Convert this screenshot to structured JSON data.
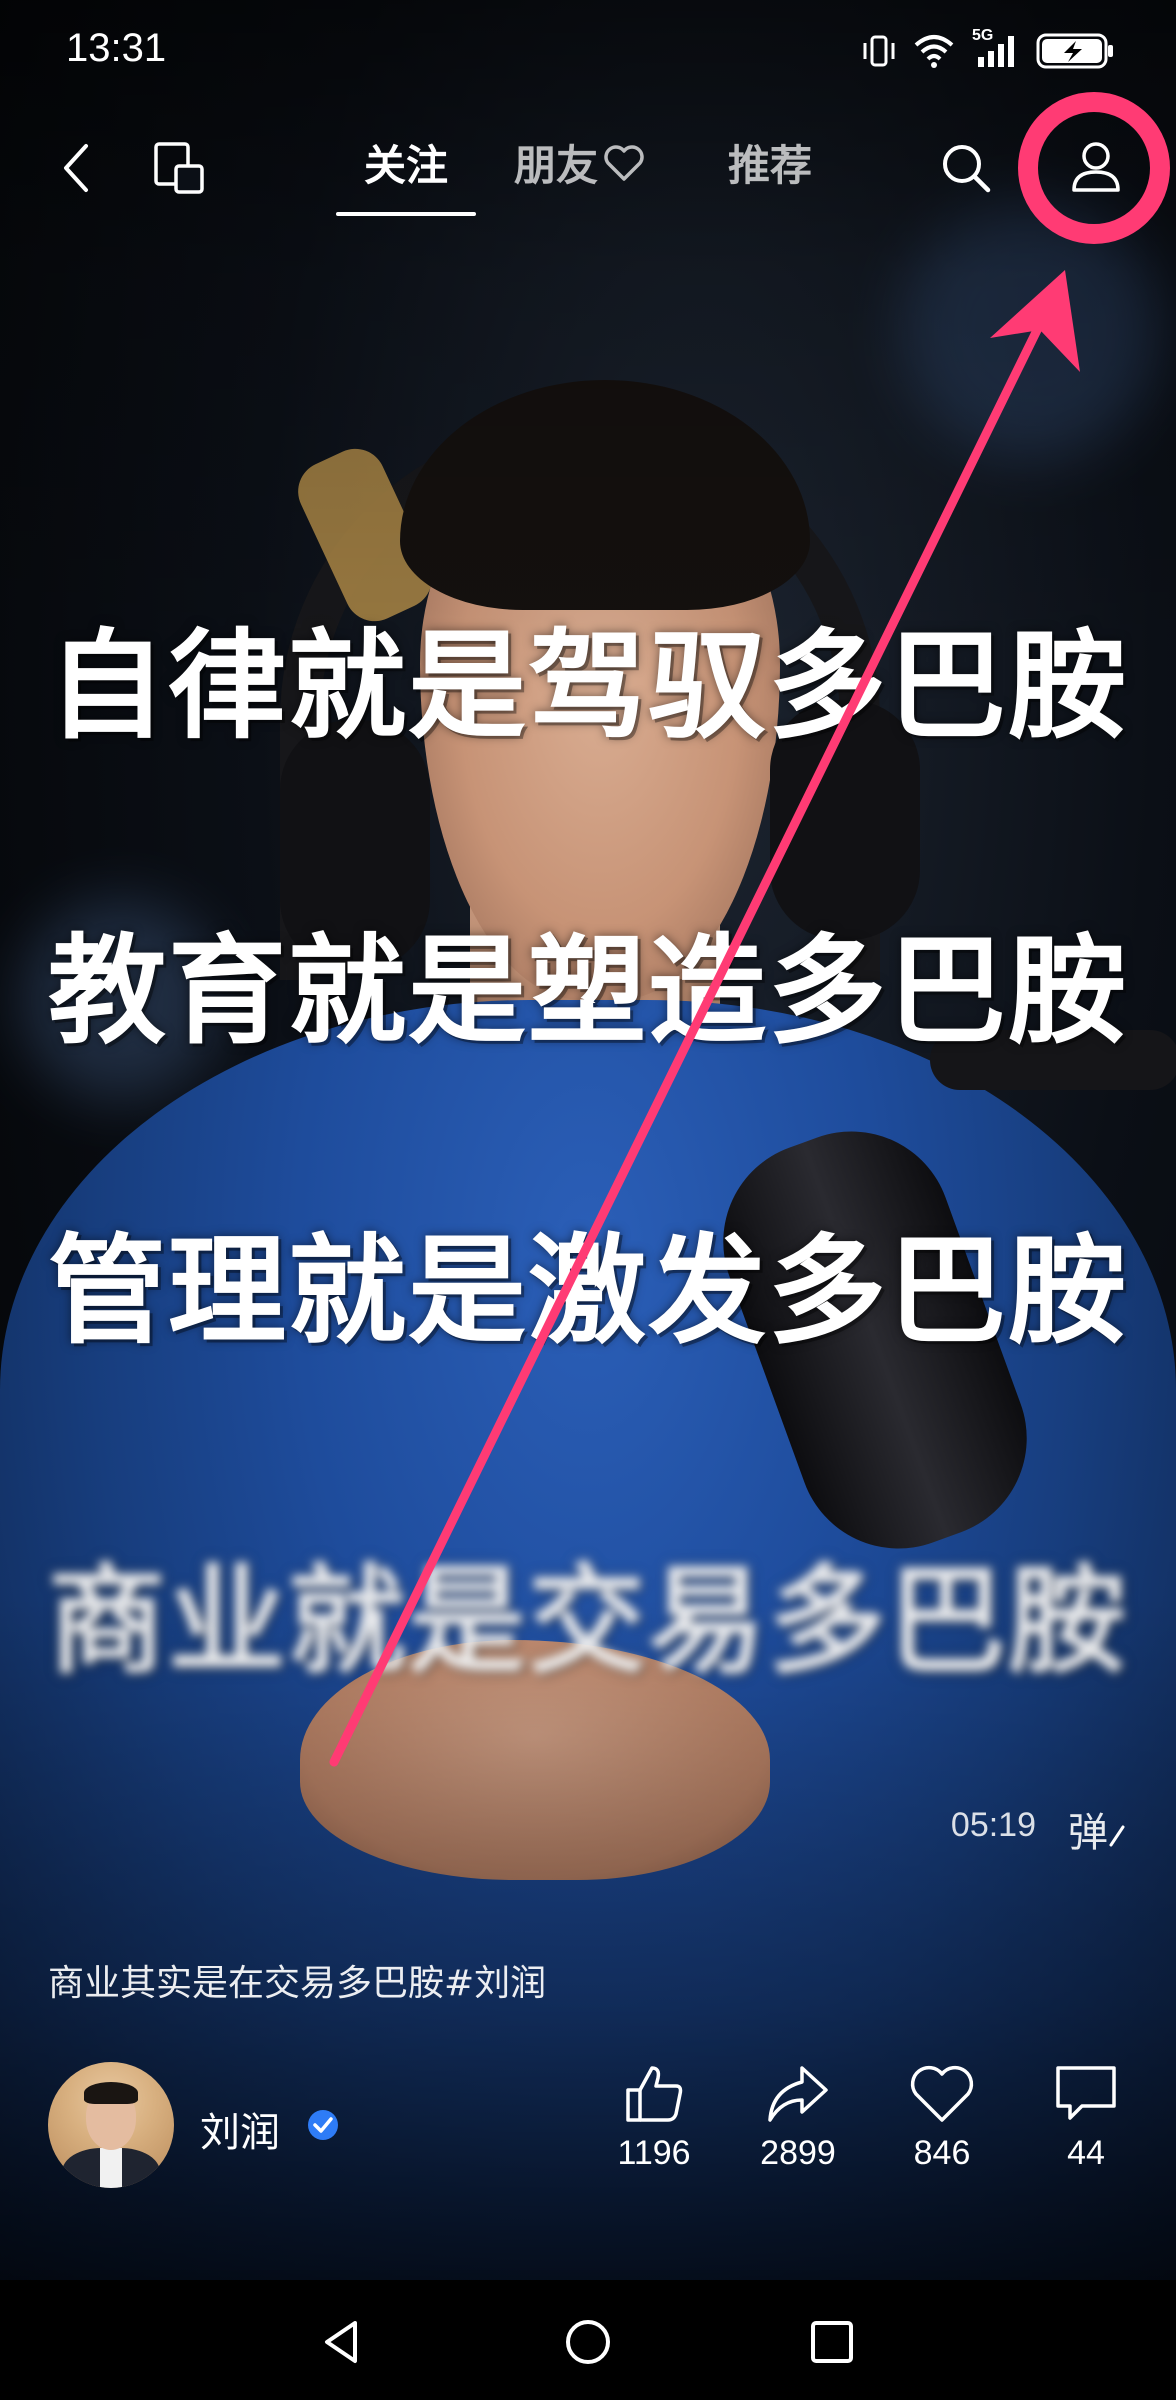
{
  "status_bar": {
    "time": "13:31",
    "network_label": "5G",
    "icons": [
      "vibrate-icon",
      "wifi-icon",
      "signal-icon",
      "battery-charging-icon"
    ]
  },
  "top_nav": {
    "back_icon": "chevron-left-icon",
    "multiwindow_icon": "multi-window-icon",
    "tabs": [
      {
        "label": "关注",
        "active": true
      },
      {
        "label": "朋友",
        "active": false,
        "icon": "heart-icon"
      },
      {
        "label": "推荐",
        "active": false
      }
    ],
    "search_icon": "search-icon",
    "profile_icon": "user-icon"
  },
  "video": {
    "captions": [
      "自律就是驾驭多巴胺",
      "教育就是塑造多巴胺",
      "管理就是激发多巴胺",
      "商业就是交易多巴胺"
    ],
    "time": "05:19",
    "danmaku_label": "弹",
    "description": "商业其实是在交易多巴胺#刘润"
  },
  "author": {
    "name": "刘润",
    "verified": true
  },
  "actions": [
    {
      "icon": "thumbs-up-icon",
      "count": "1196"
    },
    {
      "icon": "share-icon",
      "count": "2899"
    },
    {
      "icon": "heart-icon",
      "count": "846"
    },
    {
      "icon": "comment-icon",
      "count": "44"
    }
  ],
  "annotation": {
    "highlight_color": "#ff3b74"
  },
  "system_nav": [
    "back-triangle-icon",
    "home-circle-icon",
    "recents-square-icon"
  ]
}
